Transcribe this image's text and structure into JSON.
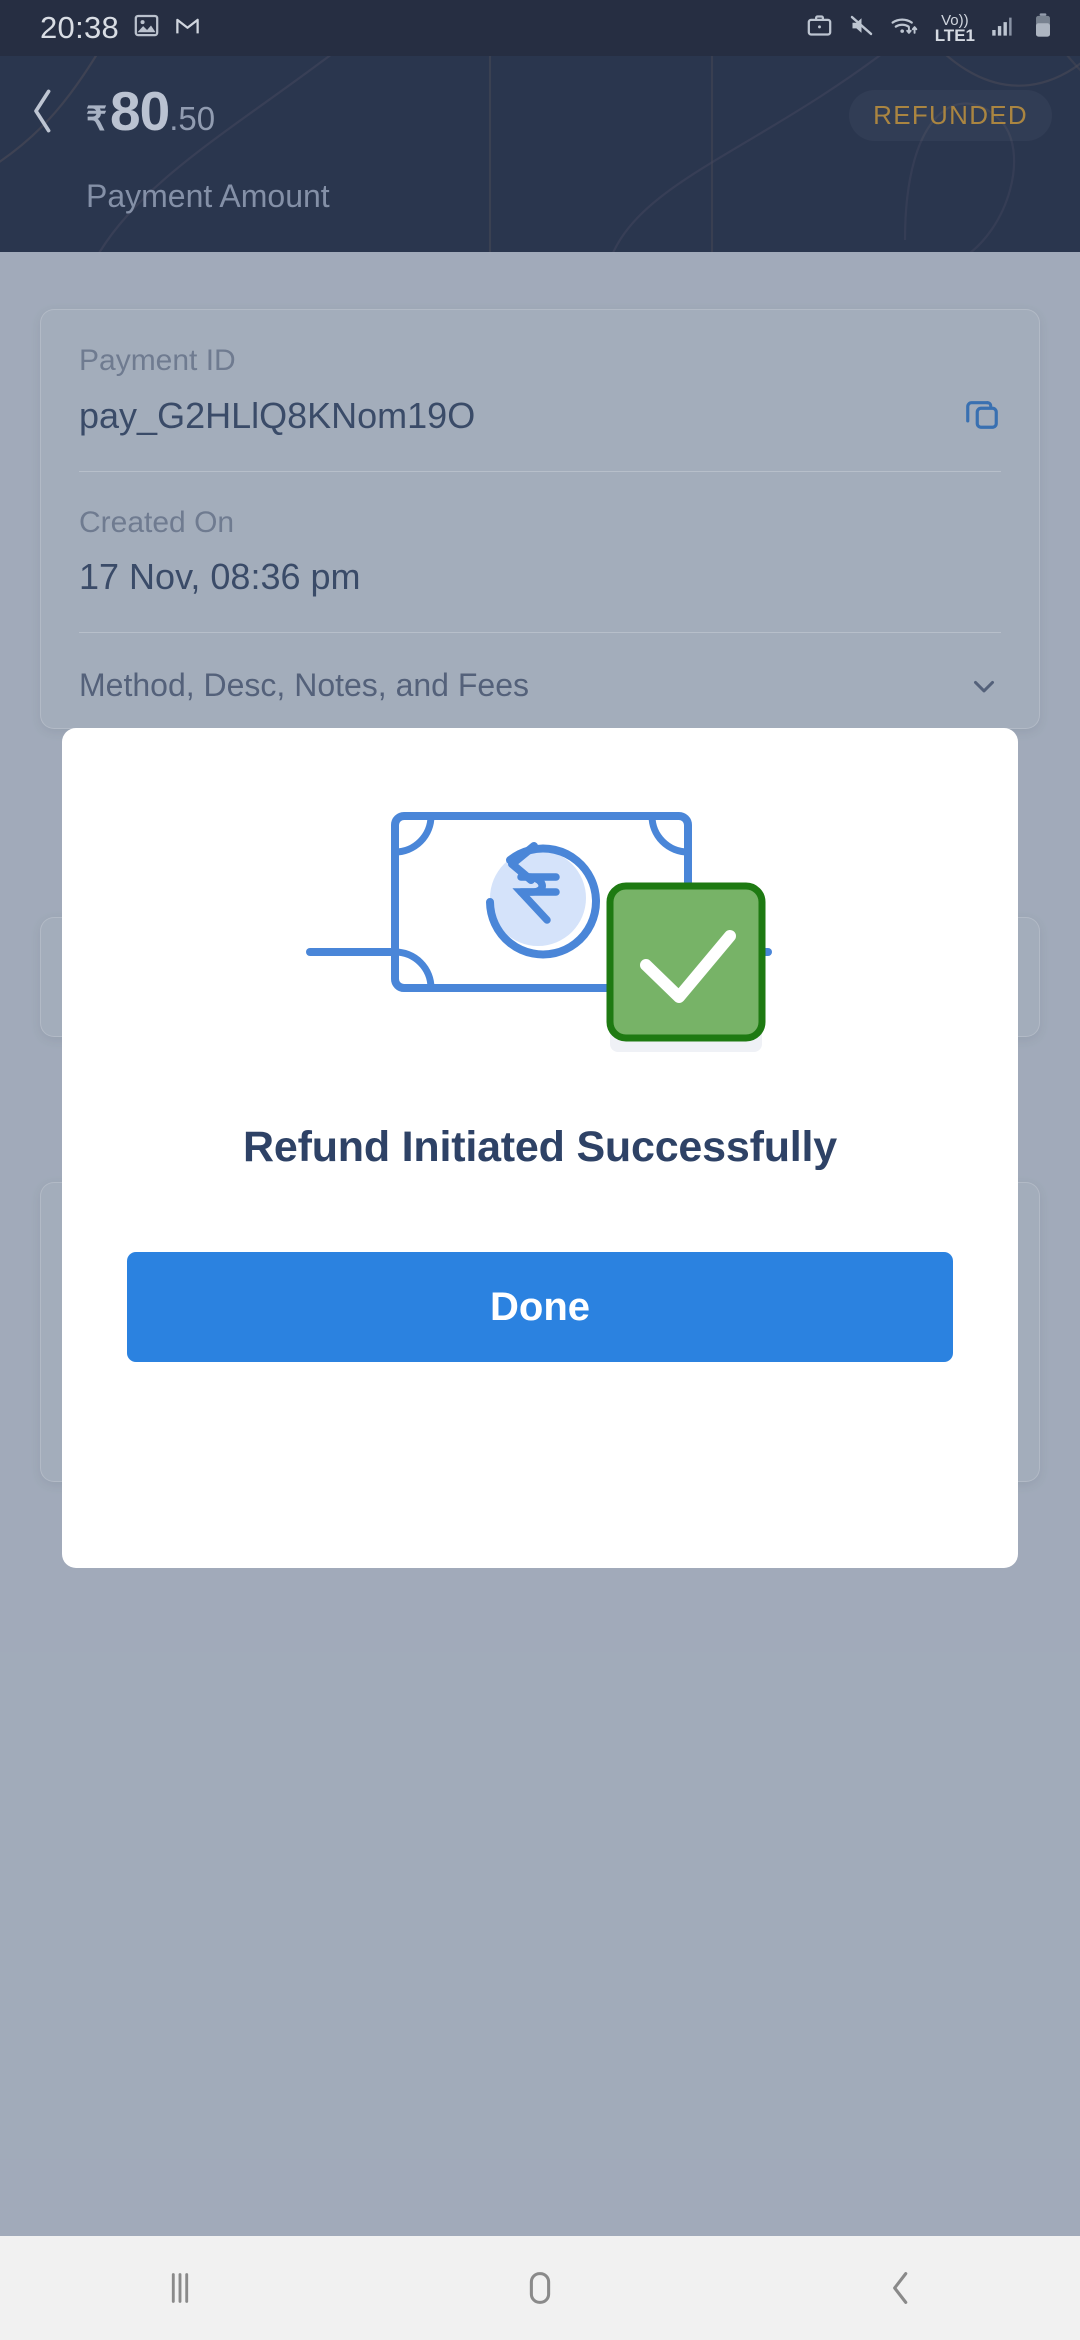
{
  "status_bar": {
    "clock": "20:38",
    "left_icons": [
      "photos-icon",
      "gmail-icon"
    ],
    "right_icons": [
      "work-profile-icon",
      "mute-icon",
      "wifi-data-icon",
      "volte1-icon",
      "signal-bars-icon",
      "battery-icon"
    ],
    "network_label": "Vo))",
    "network_sub": "LTE1"
  },
  "header": {
    "back_icon": "chevron-left-icon",
    "currency_symbol": "₹",
    "amount_major": "80",
    "amount_minor": ".50",
    "amount_label": "Payment Amount",
    "status_badge": "REFUNDED",
    "badge_color": "#b5862f",
    "background_color": "#19253f"
  },
  "details_card": {
    "fields": [
      {
        "label": "Payment ID",
        "value": "pay_G2HLlQ8KNom19O",
        "action_icon": "copy-icon"
      },
      {
        "label": "Created On",
        "value": "17 Nov, 08:36 pm"
      }
    ],
    "collapsible": {
      "label": "Method, Desc, Notes, and Fees",
      "icon": "chevron-down-icon"
    }
  },
  "modal": {
    "illustration": "refund-banknote-check-illustration",
    "title": "Refund Initiated Successfully",
    "primary_button": "Done",
    "button_color": "#2b82e0",
    "check_color": "#77b367",
    "check_border_color": "#1e7a12",
    "note_color": "#4a86d8"
  },
  "nav_bar": {
    "recents_icon": "recents-icon",
    "home_icon": "home-icon",
    "back_icon": "nav-back-icon"
  }
}
